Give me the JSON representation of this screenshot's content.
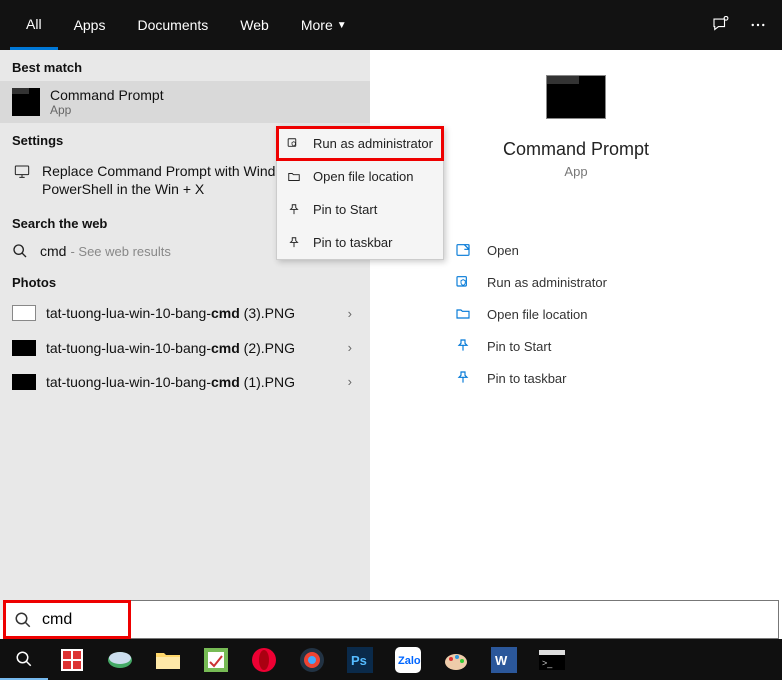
{
  "tabs": {
    "all": "All",
    "apps": "Apps",
    "documents": "Documents",
    "web": "Web",
    "more": "More"
  },
  "sections": {
    "best": "Best match",
    "settings": "Settings",
    "web": "Search the web",
    "photos": "Photos"
  },
  "bestMatch": {
    "title": "Command Prompt",
    "sub": "App"
  },
  "settingsItem": "Replace Command Prompt with Windows PowerShell in the Win + X",
  "webSearch": {
    "query": "cmd",
    "hint": " - See web results"
  },
  "photos": [
    {
      "pre": "tat-tuong-lua-win-10-bang-",
      "bold": "cmd",
      "post": " (3).PNG"
    },
    {
      "pre": "tat-tuong-lua-win-10-bang-",
      "bold": "cmd",
      "post": " (2).PNG"
    },
    {
      "pre": "tat-tuong-lua-win-10-bang-",
      "bold": "cmd",
      "post": " (1).PNG"
    }
  ],
  "context": {
    "runAdmin": "Run as administrator",
    "openLoc": "Open file location",
    "pinStart": "Pin to Start",
    "pinTask": "Pin to taskbar"
  },
  "preview": {
    "title": "Command Prompt",
    "sub": "App"
  },
  "actions": {
    "open": "Open",
    "runAdmin": "Run as administrator",
    "openLoc": "Open file location",
    "pinStart": "Pin to Start",
    "pinTask": "Pin to taskbar"
  },
  "searchValue": "cmd",
  "colors": {
    "accent": "#0078d7",
    "highlight": "#e00"
  }
}
